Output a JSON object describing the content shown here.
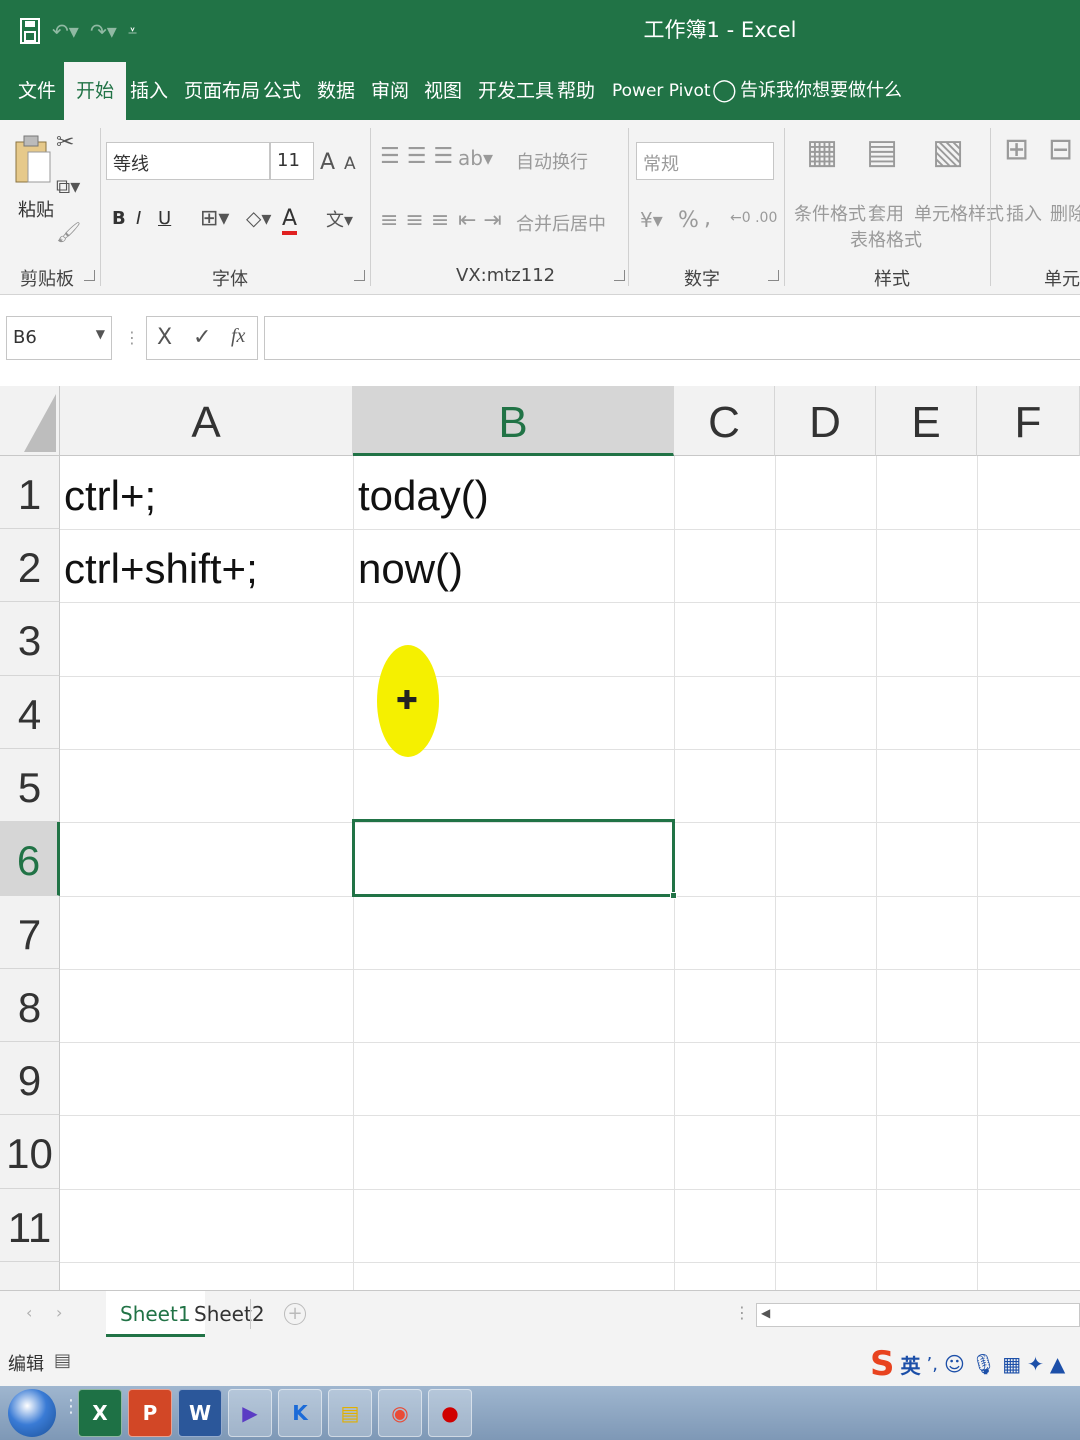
{
  "app": {
    "title": "工作簿1 - Excel",
    "accent": "#217346"
  },
  "qat": {
    "save_icon": "save-icon",
    "undo_icon": "undo-icon",
    "redo_icon": "redo-icon",
    "customize_icon": "customize-qat-icon"
  },
  "tabs": [
    {
      "label": "文件"
    },
    {
      "label": "开始"
    },
    {
      "label": "插入"
    },
    {
      "label": "页面布局"
    },
    {
      "label": "公式"
    },
    {
      "label": "数据"
    },
    {
      "label": "审阅"
    },
    {
      "label": "视图"
    },
    {
      "label": "开发工具"
    },
    {
      "label": "帮助"
    },
    {
      "label": "Power Pivot"
    }
  ],
  "tell_me": "告诉我你想要做什么",
  "ribbon": {
    "clipboard": {
      "paste": "粘贴",
      "label": "剪贴板"
    },
    "font": {
      "name": "等线",
      "size": "11",
      "grow": "A",
      "shrink": "A",
      "bold": "B",
      "italic": "I",
      "underline": "U",
      "font_color": "A",
      "label": "字体"
    },
    "alignment": {
      "wrap": "自动换行",
      "merge": "合并后居中",
      "label": "VX:mtz112"
    },
    "number": {
      "format": "常规",
      "percent": "%",
      "comma": ",",
      "label": "数字"
    },
    "styles": {
      "conditional": "条件格式",
      "table_1": "套用",
      "table_2": "表格格式",
      "cell_styles": "单元格样式",
      "label": "样式"
    },
    "cells": {
      "insert": "插入",
      "delete": "删除",
      "label": "单元格"
    }
  },
  "formula_bar": {
    "name_box": "B6",
    "cancel": "X",
    "enter": "✓",
    "fx": "fx",
    "value": ""
  },
  "columns": [
    "A",
    "B",
    "C",
    "D",
    "E",
    "F"
  ],
  "rows": [
    "1",
    "2",
    "3",
    "4",
    "5",
    "6",
    "7",
    "8",
    "9",
    "10",
    "11"
  ],
  "cells": {
    "A1": "ctrl+;",
    "B1": "today()",
    "A2": "ctrl+shift+;",
    "B2": "now()"
  },
  "selected_cell": "B6",
  "sheets": [
    {
      "label": "Sheet1"
    },
    {
      "label": "Sheet2"
    }
  ],
  "status": {
    "mode": "编辑"
  },
  "ime": {
    "brand": "S",
    "lang": "英"
  },
  "taskbar": {
    "apps": [
      "X",
      "P",
      "W",
      "▶",
      "K",
      "▤",
      "◉",
      "●"
    ]
  }
}
